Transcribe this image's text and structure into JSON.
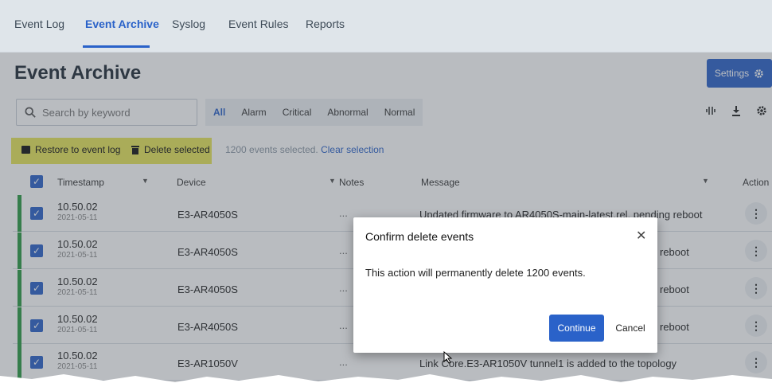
{
  "tabs": [
    "Event Log",
    "Event Archive",
    "Syslog",
    "Event Rules",
    "Reports"
  ],
  "page": {
    "title": "Event Archive",
    "settings_label": "Settings"
  },
  "search": {
    "placeholder": "Search by keyword"
  },
  "filters": [
    "All",
    "Alarm",
    "Critical",
    "Abnormal",
    "Normal"
  ],
  "actions": {
    "restore_label": "Restore to event log",
    "delete_label": "Delete selected"
  },
  "selection": {
    "count_text": "1200 events selected.",
    "clear_label": "Clear selection"
  },
  "table": {
    "headers": {
      "timestamp": "Timestamp",
      "device": "Device",
      "notes": "Notes",
      "message": "Message",
      "action": "Action"
    },
    "rows": [
      {
        "time": "10.50.02",
        "date": "2021-05-11",
        "device": "E3-AR4050S",
        "notes": "...",
        "message": "Updated firmware to AR4050S-main-latest.rel, pending reboot"
      },
      {
        "time": "10.50.02",
        "date": "2021-05-11",
        "device": "E3-AR4050S",
        "notes": "...",
        "message": "reboot"
      },
      {
        "time": "10.50.02",
        "date": "2021-05-11",
        "device": "E3-AR4050S",
        "notes": "...",
        "message": "reboot"
      },
      {
        "time": "10.50.02",
        "date": "2021-05-11",
        "device": "E3-AR4050S",
        "notes": "...",
        "message": "reboot"
      },
      {
        "time": "10.50.02",
        "date": "2021-05-11",
        "device": "E3-AR1050V",
        "notes": "...",
        "message": "Link Core.E3-AR1050V tunnel1 is added to the topology"
      }
    ]
  },
  "dialog": {
    "title": "Confirm delete events",
    "body": "This action will permanently delete 1200 events.",
    "continue_label": "Continue",
    "cancel_label": "Cancel"
  },
  "colors": {
    "accent": "#2a62c9",
    "highlight": "#e7e55a",
    "severity_normal": "#2a9a43"
  },
  "icons": [
    "search-icon",
    "gear-icon",
    "columns-icon",
    "download-icon",
    "restore-icon",
    "trash-icon",
    "checkbox-checked-icon",
    "close-icon",
    "kebab-icon",
    "mouse-cursor-icon"
  ]
}
